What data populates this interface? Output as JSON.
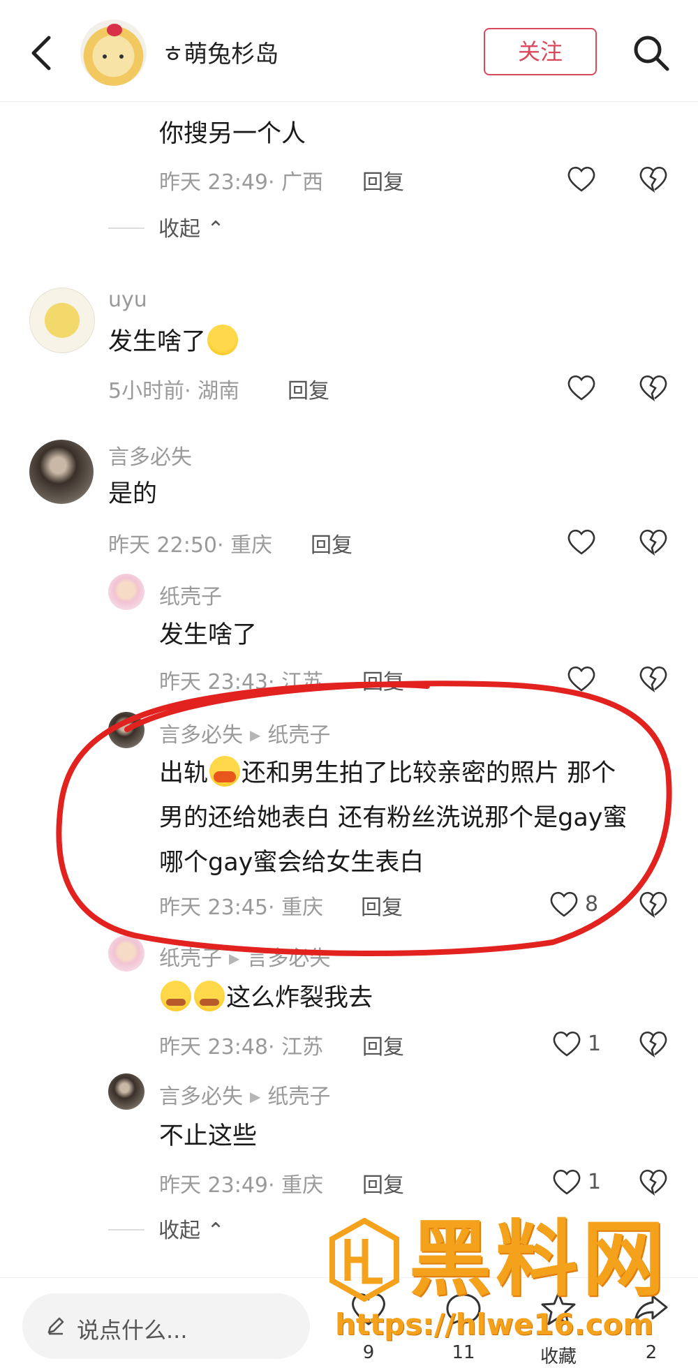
{
  "header": {
    "title": "ㅎ萌兔杉岛",
    "follow_label": "关注"
  },
  "comments": [
    {
      "text": "你搜另一个人",
      "time": "昨天 23:49",
      "location": "· 广西",
      "reply_label": "回复"
    },
    {
      "name": "uyu",
      "text": "发生啥了",
      "time": "5小时前",
      "location": "· 湖南",
      "reply_label": "回复"
    },
    {
      "name": "言多必失",
      "text": "是的",
      "time": "昨天 22:50",
      "location": "· 重庆",
      "reply_label": "回复"
    },
    {
      "name": "纸壳子",
      "text": "发生啥了",
      "time": "昨天 23:43",
      "location": "· 江苏",
      "reply_label": "回复"
    },
    {
      "name": "言多必失",
      "reply_to": "纸壳子",
      "text_line1_a": "出轨",
      "text_line1_b": "还和男生拍了比较亲密的照片 那个",
      "text_line2": "男的还给她表白 还有粉丝洗说那个是gay蜜",
      "text_line3": "哪个gay蜜会给女生表白",
      "time": "昨天 23:45",
      "location": "· 重庆",
      "reply_label": "回复",
      "likes": "8"
    },
    {
      "name": "纸壳子",
      "reply_to": "言多必失",
      "text": "这么炸裂我去",
      "time": "昨天 23:48",
      "location": "· 江苏",
      "reply_label": "回复",
      "likes": "1"
    },
    {
      "name": "言多必失",
      "reply_to": "纸壳子",
      "text": "不止这些",
      "time": "昨天 23:49",
      "location": "· 重庆",
      "reply_label": "回复",
      "likes": "1"
    }
  ],
  "collapse_label": "收起",
  "bottom": {
    "placeholder": "说点什么...",
    "likes": "9",
    "comments": "11",
    "favorites": "收藏",
    "shares": "2"
  },
  "watermark": {
    "brand": "黑料网",
    "url": "https://hlwe16.com"
  },
  "colors": {
    "accent": "#d9485b",
    "highlight_circle": "#e2221f",
    "watermark": "#f4a21c"
  },
  "icons": [
    "back-icon",
    "search-icon",
    "heart-icon",
    "broken-heart-icon",
    "pencil-icon",
    "comment-icon",
    "star-icon",
    "share-icon"
  ]
}
